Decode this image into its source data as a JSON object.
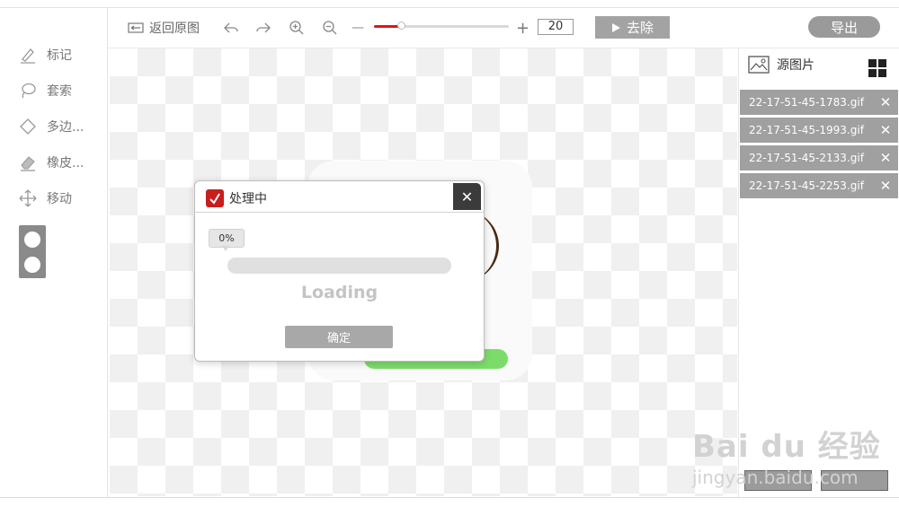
{
  "toolbar": {
    "back_label": "返回原图",
    "zoom": {
      "minus_glyph": "—",
      "plus_glyph": "+",
      "value": "20",
      "slider_fraction": 0.2
    },
    "remove_label": "去除",
    "export_label": "导出"
  },
  "tools": [
    {
      "label": "标记",
      "icon": "pen-icon"
    },
    {
      "label": "套索",
      "icon": "lasso-icon"
    },
    {
      "label": "多边...",
      "icon": "polygon-icon"
    },
    {
      "label": "橡皮...",
      "icon": "eraser-icon"
    },
    {
      "label": "移动",
      "icon": "move-icon"
    }
  ],
  "right_panel": {
    "title": "源图片",
    "files": [
      "22-17-51-45-1783.gif",
      "22-17-51-45-1993.gif",
      "22-17-51-45-2133.gif",
      "22-17-51-45-2253.gif"
    ],
    "close_glyph": "✕"
  },
  "dialog": {
    "title": "处理中",
    "close_glyph": "✕",
    "percent": "0%",
    "progress_fraction": 0,
    "loading_text": "Loading",
    "confirm_label": "确定"
  },
  "watermark": {
    "brand": "Bai du 经验",
    "url": "jingyan.baidu.com"
  },
  "colors": {
    "accent_red": "#e01414",
    "button_gray": "#a3a3a3",
    "file_item_bg": "#a0a0a0"
  }
}
